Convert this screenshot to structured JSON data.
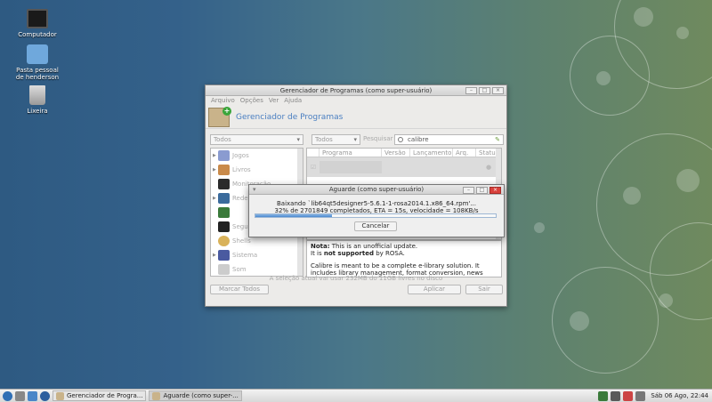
{
  "desktop": {
    "icons": [
      {
        "label": "Computador",
        "icon": "monitor-icon"
      },
      {
        "label": "Pasta pessoal de henderson",
        "icon": "home-folder-icon"
      },
      {
        "label": "Lixeira",
        "icon": "trash-icon"
      }
    ]
  },
  "main_window": {
    "title": "Gerenciador de Programas (como super-usuário)",
    "menu": [
      "Arquivo",
      "Opções",
      "Ver",
      "Ajuda"
    ],
    "banner_title": "Gerenciador de Programas",
    "filter_all": "Todos",
    "filter_status": "Todos",
    "search_label": "Pesquisar",
    "search_value": "calibre",
    "categories": [
      "Jogos",
      "Livros",
      "Monitoração",
      "Rede",
      "",
      "Segurança",
      "Shells",
      "Sistema",
      "Som"
    ],
    "columns": [
      "Programa",
      "Versão",
      "Lançamento",
      "Arq.",
      "Status"
    ],
    "description": {
      "line1_prefix": "Nota:",
      "line1_rest": " This is an unofficial update.",
      "line2_prefix": "It is ",
      "line2_bold": "not supported",
      "line2_rest": " by ROSA.",
      "para": "Calibre is meant to be a complete e-library solution. It includes library management, format conversion, news feeds to ebook conversion as well as e-book reader sync features"
    },
    "status_text": "A seleção atual vai usar 232MB do 11GB livres no disco",
    "mark_all": "Marcar Todos",
    "apply": "Aplicar",
    "quit": "Sair"
  },
  "dialog": {
    "title": "Aguarde (como super-usuário)",
    "line1": "Baixando `lib64qt5designer5-5.6.1-1-rosa2014.1.x86_64.rpm'...",
    "line2": "32% de 2701849 completados, ETA = 15s, velocidade = 108KB/s",
    "progress": 0.32,
    "cancel": "Cancelar"
  },
  "taskbar": {
    "tasks": [
      "Gerenciador de Progra...",
      "Aguarde (como super-..."
    ],
    "clock": "Sáb 06 Ago, 22:44"
  }
}
